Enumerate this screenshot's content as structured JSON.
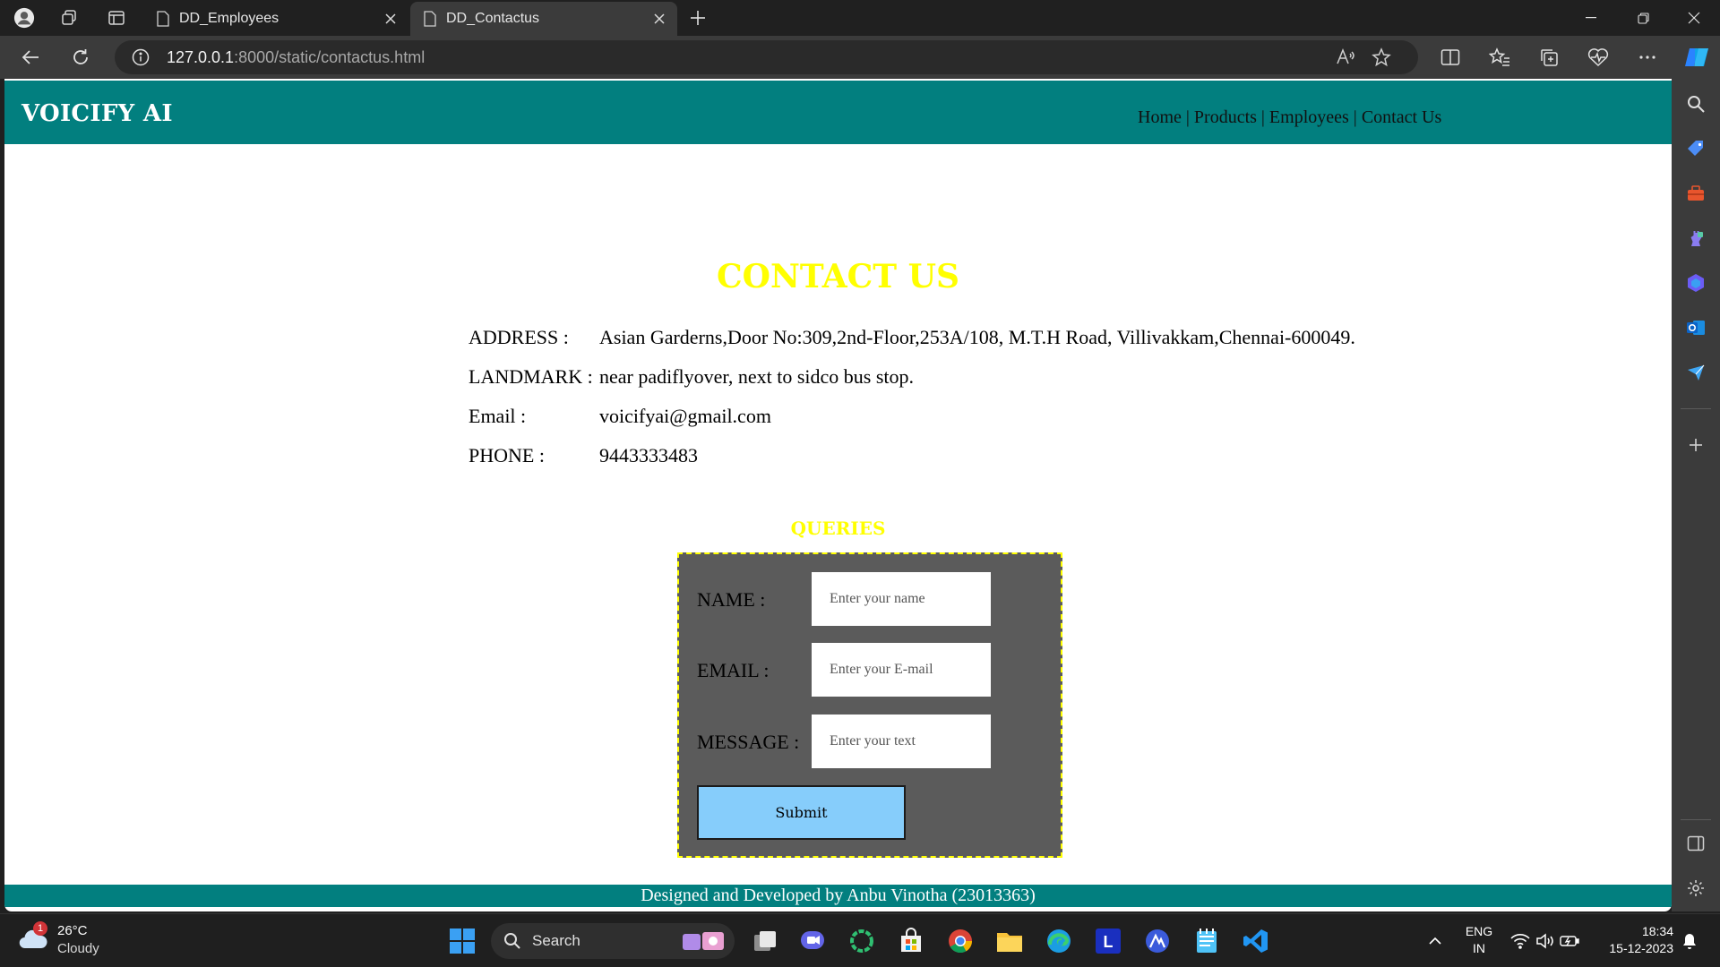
{
  "browser": {
    "tabs": [
      {
        "title": "DD_Employees",
        "active": false
      },
      {
        "title": "DD_Contactus",
        "active": true
      }
    ],
    "url_host": "127.0.0.1",
    "url_rest": ":8000/static/contactus.html"
  },
  "site": {
    "brand": "VOICIFY AI",
    "nav": {
      "home": "Home",
      "products": "Products",
      "employees": "Employees",
      "contact": "Contact Us",
      "separator": "|"
    },
    "contact_title": "CONTACT US",
    "info": [
      {
        "label": "ADDRESS :",
        "value": "Asian Garderns,Door No:309,2nd-Floor,253A/108, M.T.H Road, Villivakkam,Chennai-600049."
      },
      {
        "label": "LANDMARK :",
        "value": "near padiflyover, next to sidco bus stop."
      },
      {
        "label": "Email :",
        "value": "voicifyai@gmail.com"
      },
      {
        "label": "PHONE :",
        "value": "9443333483"
      }
    ],
    "queries_title": "QUERIES",
    "form": {
      "name_label": "NAME :",
      "name_placeholder": "Enter your name",
      "email_label": "EMAIL :",
      "email_placeholder": "Enter your E-mail",
      "message_label": "MESSAGE :",
      "message_placeholder": "Enter your text",
      "submit_label": "Submit"
    },
    "footer": "Designed and Developed by Anbu Vinotha (23013363)"
  },
  "taskbar": {
    "weather_temp": "26°C",
    "weather_condition": "Cloudy",
    "weather_badge": "1",
    "search_label": "Search",
    "lang_line1": "ENG",
    "lang_line2": "IN",
    "time": "18:34",
    "date": "15-12-2023"
  },
  "colors": {
    "header_teal": "#027f7f",
    "title_yellow": "#ffff00",
    "form_bg": "#5b5b5b",
    "submit_blue": "#86cdfb"
  }
}
